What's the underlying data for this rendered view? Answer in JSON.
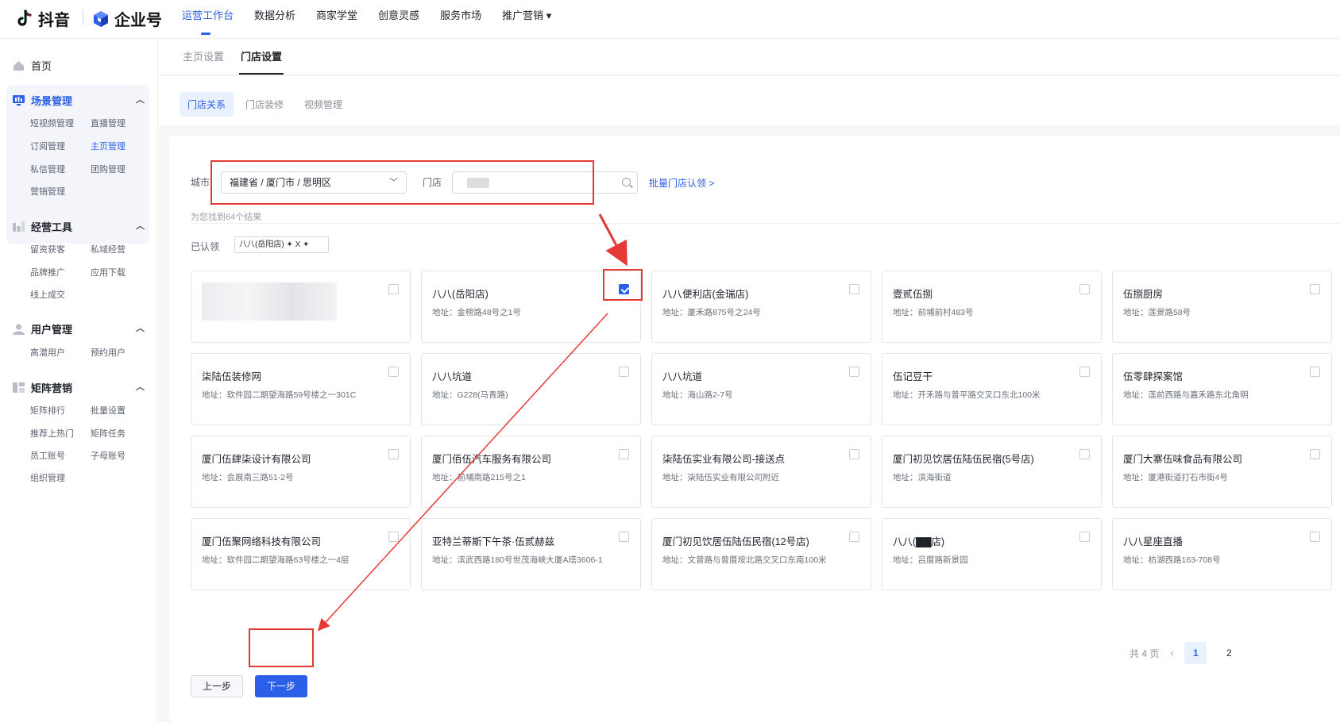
{
  "brand": {
    "douyin": "抖音",
    "enterprise": "企业号"
  },
  "topnav": [
    {
      "label": "运营工作台",
      "active": true
    },
    {
      "label": "数据分析"
    },
    {
      "label": "商家学堂"
    },
    {
      "label": "创意灵感"
    },
    {
      "label": "服务市场"
    },
    {
      "label": "推广营销 ▾"
    }
  ],
  "sidebar": {
    "home": "首页",
    "groups": [
      {
        "title": "场景管理",
        "items": [
          "短视频管理",
          "直播管理",
          "订阅管理",
          "主页管理",
          "私信管理",
          "团购管理",
          "营销管理"
        ],
        "active_item": "主页管理"
      },
      {
        "title": "经营工具",
        "items": [
          "留资获客",
          "私域经营",
          "品牌推广",
          "应用下载",
          "线上成交"
        ]
      },
      {
        "title": "用户管理",
        "items": [
          "高潜用户",
          "预约用户"
        ]
      },
      {
        "title": "矩阵营销",
        "items": [
          "矩阵排行",
          "批量设置",
          "推荐上热门",
          "矩阵任务",
          "员工账号",
          "子母账号",
          "组织管理"
        ]
      }
    ]
  },
  "tabs_main": [
    {
      "label": "主页设置"
    },
    {
      "label": "门店设置",
      "active": true
    }
  ],
  "tabs_sub": [
    {
      "label": "门店关系",
      "active": true
    },
    {
      "label": "门店装修"
    },
    {
      "label": "视频管理"
    }
  ],
  "filter": {
    "city_label": "城市",
    "city_value": "福建省 / 厦门市 / 思明区",
    "store_label": "门店",
    "batch_link": "批量门店认领 >",
    "result_text": "为您找到64个结果",
    "claimed_label": "已认领",
    "claimed_tag": "八八(岳阳店) ✦   X ✦"
  },
  "stores": [
    {
      "name": "",
      "addr": "",
      "blurred": true,
      "checked": false
    },
    {
      "name": "八八(岳阳店)",
      "addr": "地址：金榜路48号之1号",
      "checked": true
    },
    {
      "name": "八八便利店(金瑞店)",
      "addr": "地址：厦禾路875号之24号",
      "checked": false
    },
    {
      "name": "壹贰伍捌",
      "addr": "地址：前埔前村483号",
      "checked": false
    },
    {
      "name": "伍捌厨房",
      "addr": "地址：莲景路58号",
      "checked": false
    },
    {
      "name": "柒陆伍装修网",
      "addr": "地址：软件园二期望海路59号楼之一301C",
      "checked": false
    },
    {
      "name": "八八坑道",
      "addr": "地址：G228(马青路)",
      "checked": false
    },
    {
      "name": "八八坑道",
      "addr": "地址：海山路2-7号",
      "checked": false
    },
    {
      "name": "伍记豆干",
      "addr": "地址：开禾路与普平路交叉口东北100米",
      "checked": false
    },
    {
      "name": "伍零肆探案馆",
      "addr": "地址：莲前西路与嘉禾路东北角明",
      "checked": false
    },
    {
      "name": "厦门伍肆柒设计有限公司",
      "addr": "地址：会展南三路51-2号",
      "checked": false
    },
    {
      "name": "厦门佰伍汽车服务有限公司",
      "addr": "地址：前埔南路215号之1",
      "checked": false
    },
    {
      "name": "柒陆伍实业有限公司-接送点",
      "addr": "地址：柒陆伍实业有限公司附近",
      "checked": false
    },
    {
      "name": "厦门初见饮居伍陆伍民宿(5号店)",
      "addr": "地址：滨海街道",
      "checked": false
    },
    {
      "name": "厦门大寨伍味食品有限公司",
      "addr": "地址：厦港街道打石市街4号",
      "checked": false
    },
    {
      "name": "厦门伍聚网络科技有限公司",
      "addr": "地址：软件园二期望海路63号楼之一4层",
      "checked": false
    },
    {
      "name": "亚特兰蒂斯下午茶·伍贰赫兹",
      "addr": "地址：滨武西路180号世茂海峡大厦A塔3606-1",
      "checked": false
    },
    {
      "name": "厦门初见饮居伍陆伍民宿(12号店)",
      "addr": "地址：文曾路与曾厝垵北路交叉口东南100米",
      "checked": false
    },
    {
      "name": "八八(▇▇店)",
      "addr": "地址：吕厝路新景园",
      "checked": false
    },
    {
      "name": "八八星座直播",
      "addr": "地址：枋湖西路163-708号",
      "checked": false
    }
  ],
  "pager": {
    "total": "共 4 页",
    "prev": "‹",
    "pages": [
      "1",
      "2"
    ],
    "current": "1"
  },
  "buttons": {
    "prev": "上一步",
    "next": "下一步"
  },
  "colors": {
    "accent": "#2b5fe8",
    "annotation": "#e53935"
  },
  "icons": {
    "home": "home-icon",
    "scene": "monitor-icon",
    "tools": "chart-bars-icon",
    "users": "user-icon",
    "matrix": "grid-icon"
  }
}
